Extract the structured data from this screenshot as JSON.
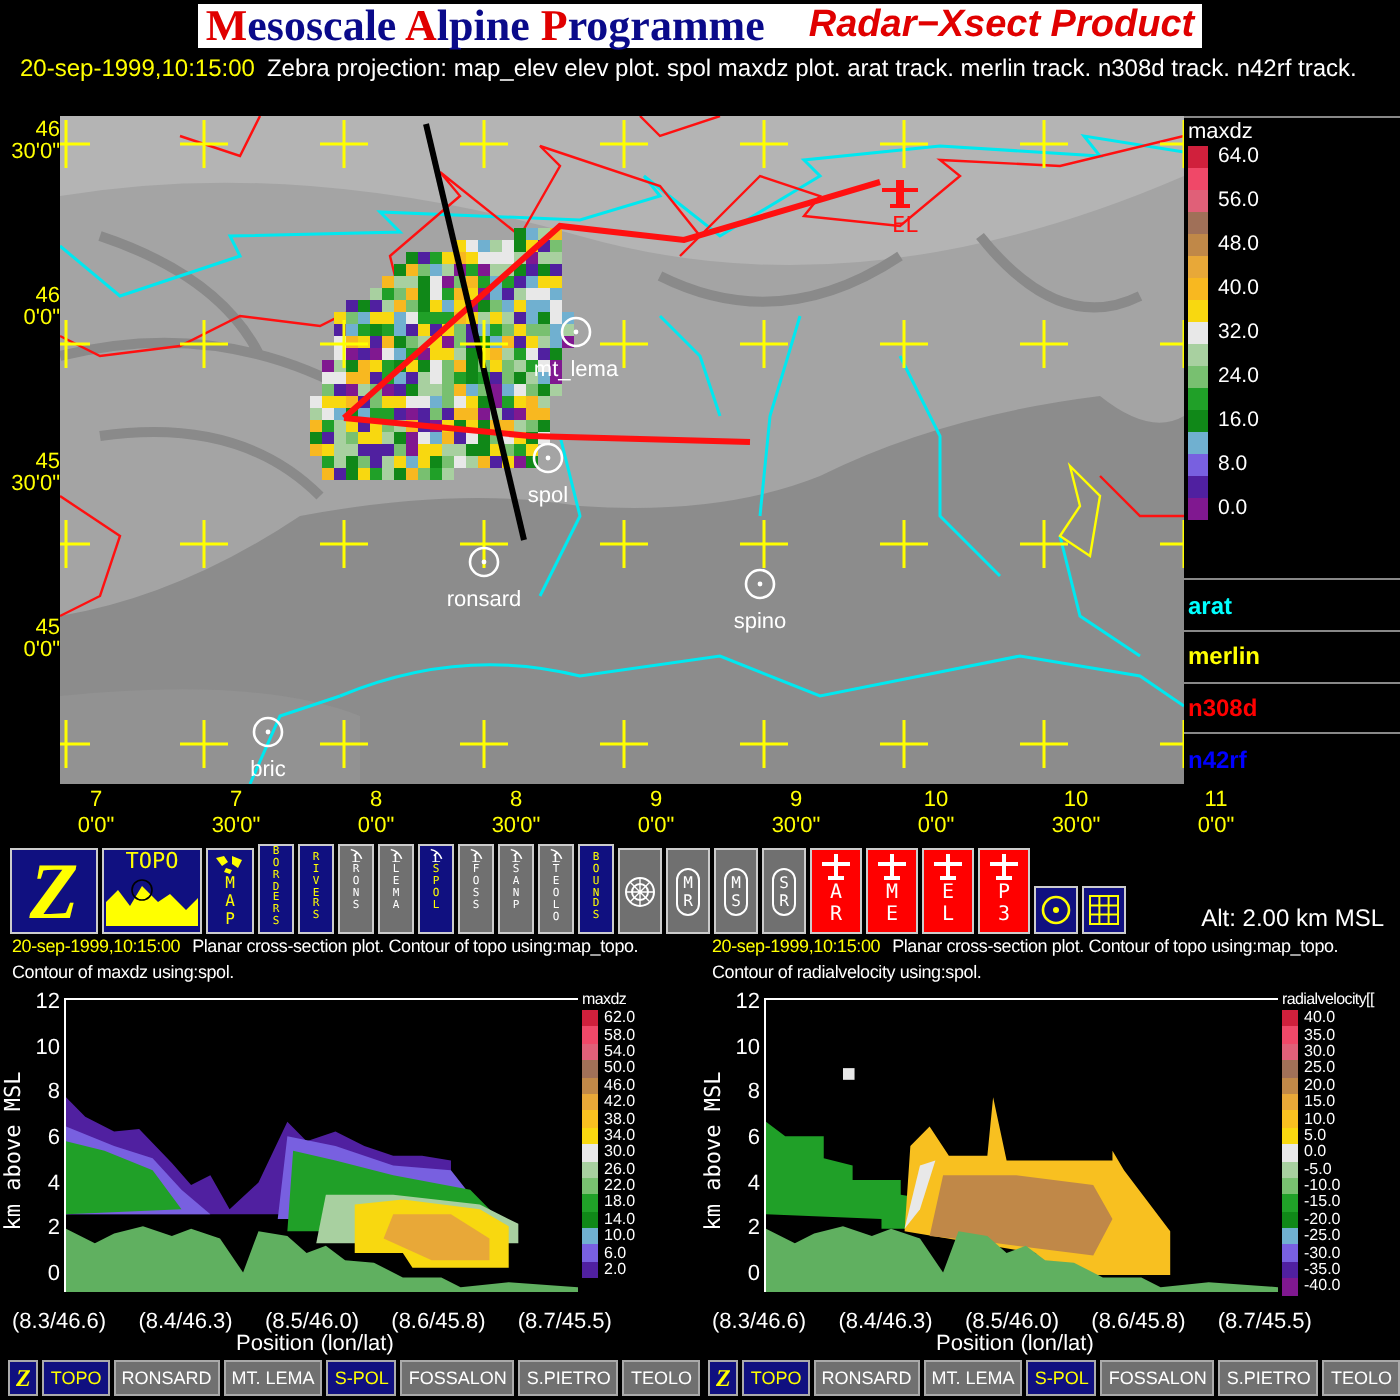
{
  "title": {
    "segments": [
      {
        "text": "M",
        "kind": "initial"
      },
      {
        "text": "esoscale ",
        "kind": "plain"
      },
      {
        "text": "A",
        "kind": "initial"
      },
      {
        "text": "lpine ",
        "kind": "plain"
      },
      {
        "text": "P",
        "kind": "initial"
      },
      {
        "text": "rogramme",
        "kind": "plain"
      }
    ],
    "product": "Radar−Xsect Product"
  },
  "header": {
    "timestamp": "20-sep-1999,10:15:00",
    "description": "Zebra projection: map_elev elev plot.  spol maxdz  plot.   arat track.   merlin track.   n308d track.   n42rf track."
  },
  "map": {
    "lat_labels": [
      {
        "deg": "46",
        "min": "30'0\""
      },
      {
        "deg": "46",
        "min": "0'0\""
      },
      {
        "deg": "45",
        "min": "30'0\""
      },
      {
        "deg": "45",
        "min": "0'0\""
      }
    ],
    "lon_labels": [
      {
        "deg": "7",
        "min": "0'0\""
      },
      {
        "deg": "7",
        "min": "30'0\""
      },
      {
        "deg": "8",
        "min": "0'0\""
      },
      {
        "deg": "8",
        "min": "30'0\""
      },
      {
        "deg": "9",
        "min": "0'0\""
      },
      {
        "deg": "9",
        "min": "30'0\""
      },
      {
        "deg": "10",
        "min": "0'0\""
      },
      {
        "deg": "10",
        "min": "30'0\""
      },
      {
        "deg": "11",
        "min": "0'0\""
      }
    ],
    "stations": [
      {
        "name": "mt_lema"
      },
      {
        "name": "spol"
      },
      {
        "name": "ronsard"
      },
      {
        "name": "spino"
      },
      {
        "name": "bric"
      }
    ],
    "aircraft_marker": "EL",
    "legend": {
      "title": "maxdz",
      "swatches": [
        {
          "color": "#d0203c",
          "label": "64.0"
        },
        {
          "color": "#f04868"
        },
        {
          "color": "#e06078",
          "label": "56.0"
        },
        {
          "color": "#a07058"
        },
        {
          "color": "#c08848",
          "label": "48.0"
        },
        {
          "color": "#e8a838"
        },
        {
          "color": "#f8b820",
          "label": "40.0"
        },
        {
          "color": "#f8d810"
        },
        {
          "color": "#e8e8e8",
          "label": "32.0"
        },
        {
          "color": "#a8d0a0"
        },
        {
          "color": "#78c070",
          "label": "24.0"
        },
        {
          "color": "#20a028"
        },
        {
          "color": "#108818",
          "label": "16.0"
        },
        {
          "color": "#70b0d0"
        },
        {
          "color": "#7860e0",
          "label": "8.0"
        },
        {
          "color": "#5020a0"
        },
        {
          "color": "#801890",
          "label": "0.0"
        }
      ]
    },
    "tracks": [
      {
        "label": "arat",
        "color": "#00ffff"
      },
      {
        "label": "merlin",
        "color": "#ffff00"
      },
      {
        "label": "n308d",
        "color": "#ff0000"
      },
      {
        "label": "n42rf",
        "color": "#0000ff"
      }
    ]
  },
  "toolbar": [
    {
      "kind": "logo",
      "label": "Z",
      "on": true
    },
    {
      "kind": "topo",
      "label": "TOPO",
      "on": true
    },
    {
      "kind": "map",
      "label": "MAP",
      "on": true
    },
    {
      "kind": "vertical",
      "label": "BORDERS",
      "on": true
    },
    {
      "kind": "vertical",
      "label": "RIVERS",
      "on": true
    },
    {
      "kind": "station",
      "label": "RONS",
      "on": false
    },
    {
      "kind": "station",
      "label": "LEMA",
      "on": false
    },
    {
      "kind": "station",
      "label": "SPOL",
      "on": true
    },
    {
      "kind": "station",
      "label": "FOSS",
      "on": false
    },
    {
      "kind": "station",
      "label": "SANP",
      "on": false
    },
    {
      "kind": "station",
      "label": "TEOLO",
      "on": false
    },
    {
      "kind": "vertical",
      "label": "BOUNDS",
      "on": true
    },
    {
      "kind": "ring",
      "on": false
    },
    {
      "kind": "pair",
      "label": "MR",
      "on": false
    },
    {
      "kind": "pair",
      "label": "MS",
      "on": false
    },
    {
      "kind": "pair",
      "label": "SR",
      "on": false
    },
    {
      "kind": "aircraft",
      "label": "AR",
      "on": true
    },
    {
      "kind": "aircraft",
      "label": "ME",
      "on": true
    },
    {
      "kind": "aircraft",
      "label": "EL",
      "on": true
    },
    {
      "kind": "aircraft",
      "label": "P3",
      "on": true
    },
    {
      "kind": "target",
      "on": true
    },
    {
      "kind": "grid",
      "on": true
    }
  ],
  "altitude": "Alt: 2.00 km MSL",
  "panels": [
    {
      "kind": "reflectivity",
      "timestamp": "20-sep-1999,10:15:00",
      "line1": "Planar cross-section plot.  Contour of topo using:map_topo.",
      "line2": "Contour of maxdz using:spol.",
      "ylabel": "km above MSL",
      "xlabel": "Position (lon/lat)",
      "yticks": [
        "12",
        "10",
        "8",
        "6",
        "4",
        "2",
        "0"
      ],
      "xticks": [
        "(8.3/46.6)",
        "(8.4/46.3)",
        "(8.5/46.0)",
        "(8.6/45.8)",
        "(8.7/45.5)"
      ],
      "legend": {
        "title": "maxdz",
        "swatches": [
          {
            "color": "#d0203c",
            "label": "62.0"
          },
          {
            "color": "#f04868",
            "label": "58.0"
          },
          {
            "color": "#e06078",
            "label": "54.0"
          },
          {
            "color": "#a07058",
            "label": "50.0"
          },
          {
            "color": "#c08848",
            "label": "46.0"
          },
          {
            "color": "#e8a838",
            "label": "42.0"
          },
          {
            "color": "#f8c020",
            "label": "38.0"
          },
          {
            "color": "#f8d810",
            "label": "34.0"
          },
          {
            "color": "#e8e8e8",
            "label": "30.0"
          },
          {
            "color": "#a8d0a0",
            "label": "26.0"
          },
          {
            "color": "#78c070",
            "label": "22.0"
          },
          {
            "color": "#20a028",
            "label": "18.0"
          },
          {
            "color": "#108818",
            "label": "14.0"
          },
          {
            "color": "#70b0d0",
            "label": "10.0"
          },
          {
            "color": "#7860e0",
            "label": "6.0"
          },
          {
            "color": "#5020a0",
            "label": "2.0"
          }
        ]
      },
      "buttons": [
        {
          "kind": "logo",
          "label": "Z",
          "on": true
        },
        {
          "kind": "text",
          "label": "TOPO",
          "on": true
        },
        {
          "kind": "text",
          "label": "RONSARD",
          "on": false
        },
        {
          "kind": "text",
          "label": "MT. LEMA",
          "on": false
        },
        {
          "kind": "text",
          "label": "S-POL",
          "on": true
        },
        {
          "kind": "text",
          "label": "FOSSALON",
          "on": false
        },
        {
          "kind": "text",
          "label": "S.PIETRO",
          "on": false
        },
        {
          "kind": "text",
          "label": "TEOLO",
          "on": false
        }
      ]
    },
    {
      "kind": "velocity",
      "timestamp": "20-sep-1999,10:15:00",
      "line1": "Planar cross-section plot.  Contour of topo using:map_topo.",
      "line2": "Contour of radialvelocity using:spol.",
      "ylabel": "km above MSL",
      "xlabel": "Position (lon/lat)",
      "yticks": [
        "12",
        "10",
        "8",
        "6",
        "4",
        "2",
        "0"
      ],
      "xticks": [
        "(8.3/46.6)",
        "(8.4/46.3)",
        "(8.5/46.0)",
        "(8.6/45.8)",
        "(8.7/45.5)"
      ],
      "legend": {
        "title": "radialvelocity[[",
        "swatches": [
          {
            "color": "#d0203c",
            "label": "40.0"
          },
          {
            "color": "#f04868",
            "label": "35.0"
          },
          {
            "color": "#e06078",
            "label": "30.0"
          },
          {
            "color": "#a07058",
            "label": "25.0"
          },
          {
            "color": "#c08848",
            "label": "20.0"
          },
          {
            "color": "#e8a838",
            "label": "15.0"
          },
          {
            "color": "#f8c020",
            "label": "10.0"
          },
          {
            "color": "#f8d810",
            "label": "5.0"
          },
          {
            "color": "#e8e8e8",
            "label": "0.0"
          },
          {
            "color": "#a8d0a0",
            "label": "-5.0"
          },
          {
            "color": "#78c070",
            "label": "-10.0"
          },
          {
            "color": "#20a028",
            "label": "-15.0"
          },
          {
            "color": "#108818",
            "label": "-20.0"
          },
          {
            "color": "#70b0d0",
            "label": "-25.0"
          },
          {
            "color": "#7860e0",
            "label": "-30.0"
          },
          {
            "color": "#5020a0",
            "label": "-35.0"
          },
          {
            "color": "#801890",
            "label": "-40.0"
          }
        ]
      },
      "buttons": [
        {
          "kind": "logo",
          "label": "Z",
          "on": true
        },
        {
          "kind": "text",
          "label": "TOPO",
          "on": true
        },
        {
          "kind": "text",
          "label": "RONSARD",
          "on": false
        },
        {
          "kind": "text",
          "label": "MT. LEMA",
          "on": false
        },
        {
          "kind": "text",
          "label": "S-POL",
          "on": true
        },
        {
          "kind": "text",
          "label": "FOSSALON",
          "on": false
        },
        {
          "kind": "text",
          "label": "S.PIETRO",
          "on": false
        },
        {
          "kind": "text",
          "label": "TEOLO",
          "on": false
        }
      ]
    }
  ]
}
